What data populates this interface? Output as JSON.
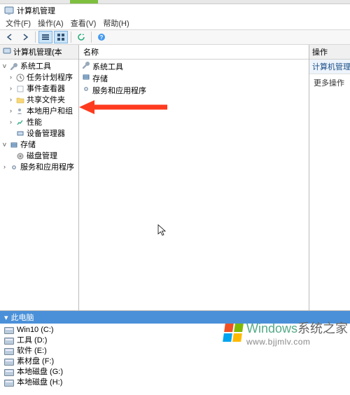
{
  "title": "计算机管理",
  "menubar": [
    "文件(F)",
    "操作(A)",
    "查看(V)",
    "帮助(H)"
  ],
  "tree_root": "计算机管理(本",
  "tree": {
    "sys_tools": "系统工具",
    "task_sched": "任务计划程序",
    "event_viewer": "事件查看器",
    "shared": "共享文件夹",
    "local_users": "本地用户和组",
    "perf": "性能",
    "devmgr": "设备管理器",
    "storage": "存储",
    "diskmgr": "磁盘管理",
    "services": "服务和应用程序"
  },
  "list_header": "名称",
  "list_items": [
    "系统工具",
    "存储",
    "服务和应用程序"
  ],
  "actions_header": "操作",
  "actions_sub": "计算机管理(本",
  "actions_more": "更多操作",
  "bottom_header": "此电脑",
  "drives": [
    "Win10 (C:)",
    "工具 (D:)",
    "软件 (E:)",
    "素材盘 (F:)",
    "本地磁盘 (G:)",
    "本地磁盘 (H:)"
  ],
  "watermark_main": "Windows",
  "watermark_sub": "系统之家",
  "watermark_url": "www.bjjmlv.com"
}
